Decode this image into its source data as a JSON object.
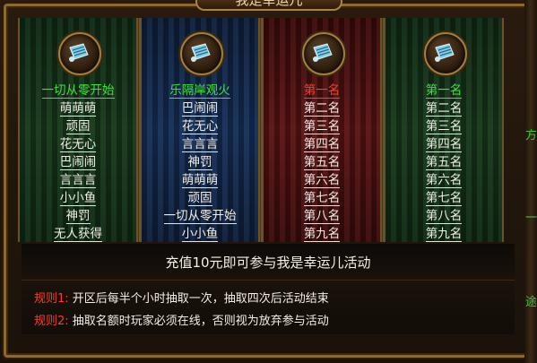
{
  "title": "我是幸运儿",
  "columns": [
    {
      "items": [
        "一切从零开始",
        "萌萌萌",
        "顽固",
        "花无心",
        "巴闹闹",
        "言言言",
        "小小鱼",
        "神罚",
        "无人获得"
      ],
      "highlight_color": "#3fe23f"
    },
    {
      "items": [
        "乐隔岸观火",
        "巴闹闹",
        "花无心",
        "言言言",
        "神罚",
        "萌萌萌",
        "顽固",
        "一切从零开始",
        "小小鱼"
      ],
      "highlight_color": "#3fe23f"
    },
    {
      "items": [
        "第一名",
        "第二名",
        "第三名",
        "第四名",
        "第五名",
        "第六名",
        "第七名",
        "第八名",
        "第九名"
      ],
      "highlight_color": "#ff3b2f"
    },
    {
      "items": [
        "第一名",
        "第二名",
        "第三名",
        "第四名",
        "第五名",
        "第六名",
        "第七名",
        "第八名",
        "第九名"
      ],
      "highlight_color": "#3fe23f"
    }
  ],
  "banner": "充值10元即可参与我是幸运儿活动",
  "rules": [
    {
      "label": "规则1:",
      "text": "开区后每半个小时抽取一次，抽取四次后活动结束"
    },
    {
      "label": "规则2:",
      "text": "抽取名额时玩家必须在线，否则视为放弃参与活动"
    }
  ],
  "icons": [
    "scroll-medal-icon"
  ],
  "colors": {
    "green": "#3fe23f",
    "red": "#ff3b2f",
    "gold": "#a2803c"
  }
}
